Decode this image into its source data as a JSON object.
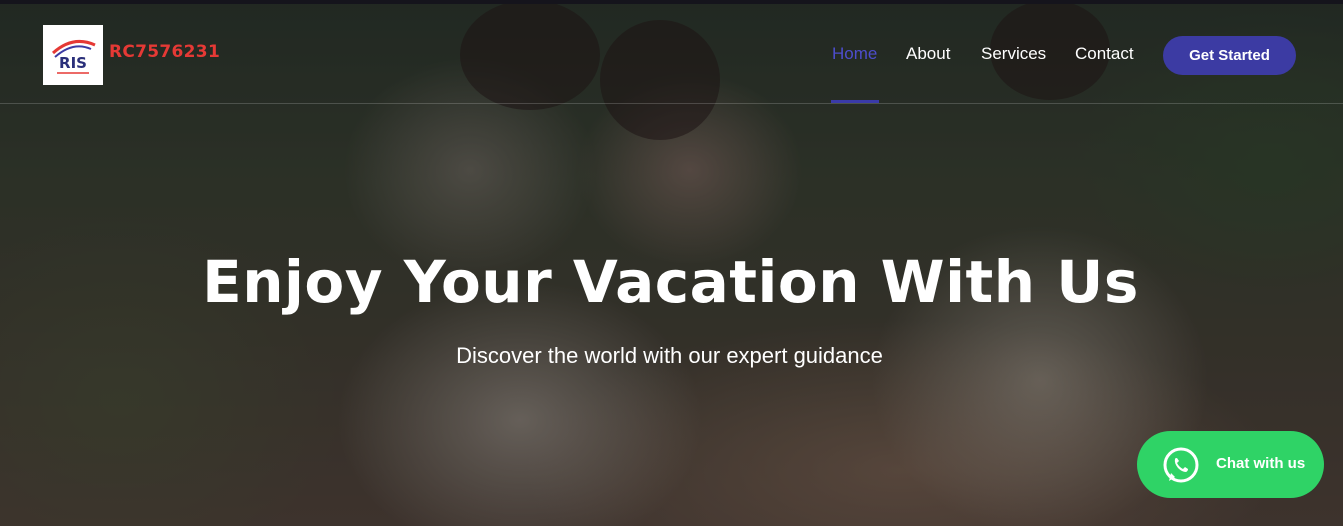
{
  "header": {
    "logo": {
      "text": "RIS",
      "icon": "ris-logo"
    },
    "brand_name": "RC7576231"
  },
  "nav": {
    "items": [
      {
        "label": "Home",
        "active": true
      },
      {
        "label": "About",
        "active": false
      },
      {
        "label": "Services",
        "active": false
      },
      {
        "label": "Contact",
        "active": false
      }
    ],
    "cta_label": "Get Started"
  },
  "hero": {
    "title": "Enjoy Your Vacation With Us",
    "subtitle": "Discover the world with our expert guidance"
  },
  "chat": {
    "label": "Chat with us",
    "icon": "whatsapp-icon"
  },
  "colors": {
    "accent": "#3c3ba3",
    "brand_text": "#e53935",
    "nav_active": "#4d4dcc",
    "whatsapp_green": "#2fd366"
  }
}
